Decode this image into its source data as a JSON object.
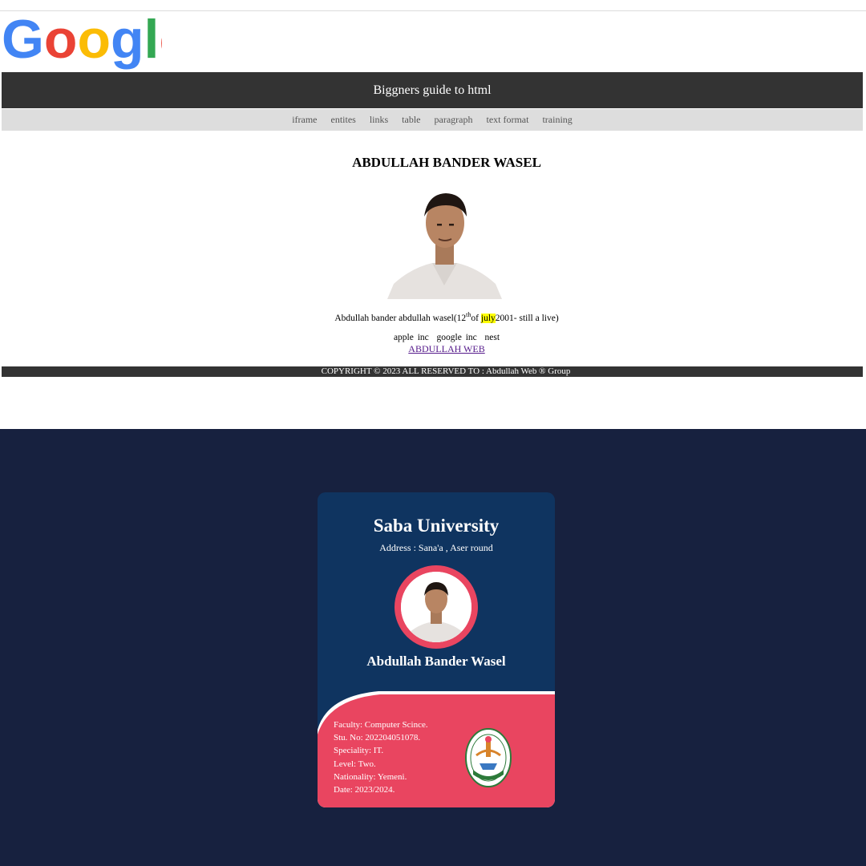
{
  "logo": {
    "text": "Google",
    "colors": [
      "#4285f4",
      "#ea4335",
      "#fbbc05",
      "#4285f4",
      "#34a853",
      "#ea4335"
    ]
  },
  "header": {
    "title": "Biggners guide to html"
  },
  "nav": {
    "items": [
      "iframe",
      "entites",
      "links",
      "table",
      "paragraph",
      "text format",
      "training"
    ]
  },
  "main": {
    "title": "ABDULLAH BANDER WASEL",
    "bio": {
      "prefix": "Abdullah bander abdullah wasel(12",
      "sup": "th",
      "of": "of ",
      "highlight": "july",
      "suffix": "2001- still a live)"
    },
    "companies": "apple inc  google inc  nest",
    "link_text": "ABDULLAH WEB"
  },
  "footer": {
    "text": "COPYRIGHT © 2023 ALL RESERVED TO : Abdullah Web ® Group"
  },
  "id_card": {
    "university": "Saba University",
    "address": "Address : Sana'a , Aser round",
    "name": "Abdullah Bander Wasel",
    "details": [
      "Faculty: Computer Scince.",
      "Stu. No: 202204051078.",
      "Speciality: IT.",
      "Level: Two.",
      "Nationality: Yemeni.",
      "Date: 2023/2024."
    ],
    "colors": {
      "card": "#0f3460",
      "accent": "#e94560",
      "background": "#17213f"
    }
  }
}
